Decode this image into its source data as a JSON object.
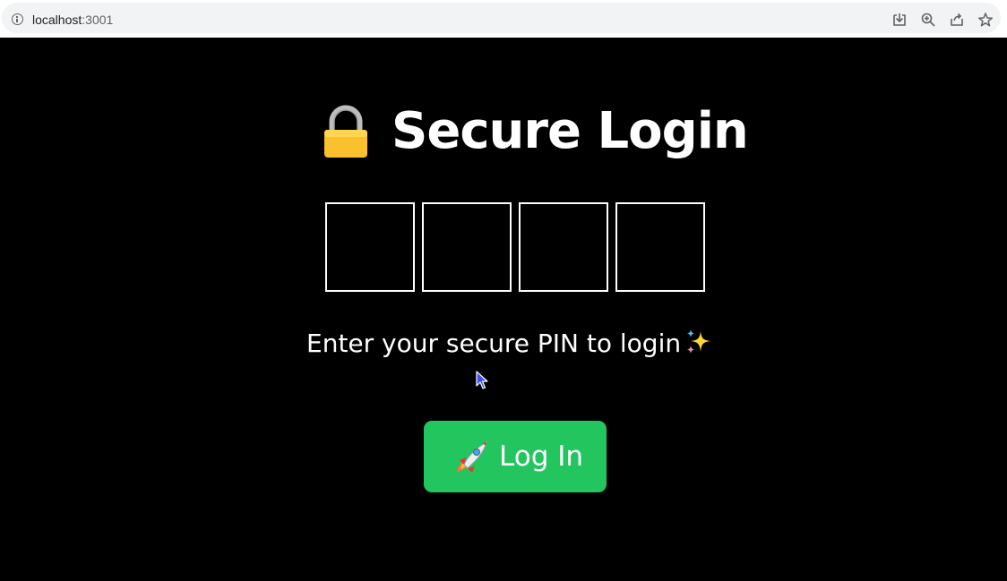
{
  "browser": {
    "url_host": "localhost",
    "url_port": ":3001",
    "icons": [
      "info-icon",
      "install-icon",
      "zoom-icon",
      "share-icon",
      "bookmark-star-icon"
    ]
  },
  "login": {
    "title": "Secure Login",
    "title_icon": "lock-icon",
    "pin_digits": [
      "",
      "",
      "",
      ""
    ],
    "prompt": "Enter your secure PIN to login",
    "prompt_icon": "sparkles-icon",
    "button_label": "Log In",
    "button_icon": "rocket-icon"
  },
  "colors": {
    "background": "#000000",
    "text": "#ffffff",
    "button": "#22c55e",
    "pin_border": "#ffffff"
  }
}
